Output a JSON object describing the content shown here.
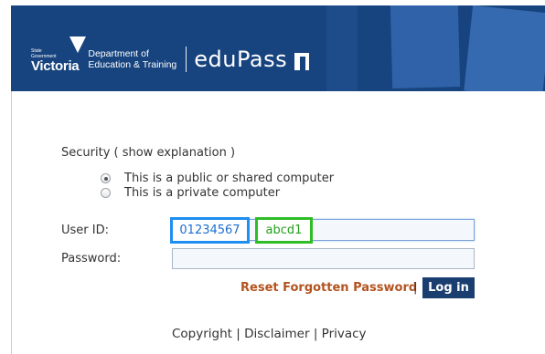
{
  "header": {
    "vic_logo_small": [
      "State",
      "Government"
    ],
    "vic_logo_big": "Victoria",
    "department_line1": "Department of",
    "department_line2": "Education & Training",
    "app_name": "eduPass",
    "logo_icon": "edupass-logo-icon",
    "colors": {
      "banner": "#17447f",
      "tile": "#2f62a8"
    }
  },
  "security": {
    "label": "Security ( show explanation )",
    "options": [
      {
        "label": "This is a public or shared computer",
        "selected": true
      },
      {
        "label": "This is a private computer",
        "selected": false
      }
    ]
  },
  "form": {
    "user_id_label": "User ID:",
    "password_label": "Password:",
    "user_id_parts": [
      "01234567",
      "abcd1"
    ],
    "reset_link": "Reset Forgotten Password",
    "separator": "|",
    "login_button": "Log in"
  },
  "footer": {
    "links": [
      "Copyright",
      "Disclaimer",
      "Privacy"
    ],
    "separator": "|"
  },
  "colors": {
    "reset_link": "#b3531e",
    "login_button": "#1a3e6f",
    "highlight_blue": "#1e8ef0",
    "highlight_green": "#2ebd25"
  }
}
